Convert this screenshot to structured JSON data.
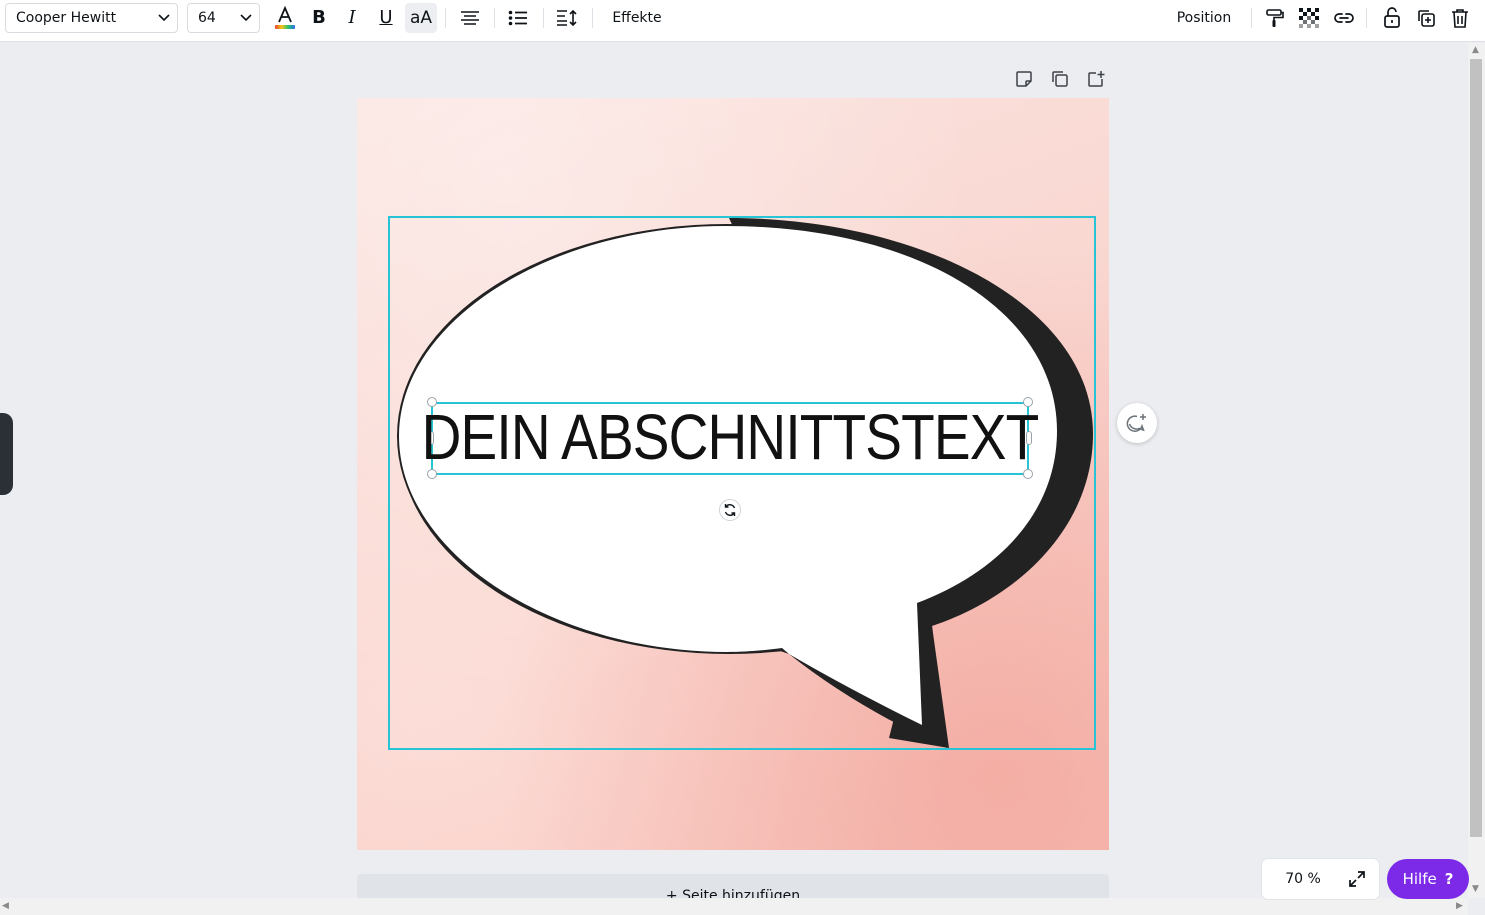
{
  "toolbar": {
    "font_family": "Cooper Hewitt",
    "font_size": "64",
    "effects_label": "Effekte",
    "position_label": "Position",
    "text_color_swatch": "#e8412e",
    "icons": {
      "text_color": "text-color-icon",
      "bold": "bold-icon",
      "italic": "italic-icon",
      "underline": "underline-icon",
      "case": "letter-case-icon",
      "align": "align-center-icon",
      "list": "bullet-list-icon",
      "spacing": "line-spacing-icon",
      "paint": "copy-style-icon",
      "transparency": "transparency-icon",
      "link": "link-icon",
      "lock": "lock-icon",
      "duplicate": "duplicate-icon",
      "delete": "trash-icon"
    },
    "glyphs": {
      "bold": "B",
      "italic": "I",
      "underline": "U",
      "case": "aA"
    }
  },
  "canvas": {
    "headline": "DEIN ABSCHNITTSTEXT",
    "selection_color": "#27c4d5",
    "add_page_label": "+ Seite hinzufügen",
    "page_tools": [
      "note-icon",
      "copy-page-icon",
      "add-page-icon"
    ]
  },
  "footer": {
    "zoom": "70 %",
    "help_label": "Hilfe",
    "help_glyph": "?",
    "help_color": "#7d2ae8"
  }
}
